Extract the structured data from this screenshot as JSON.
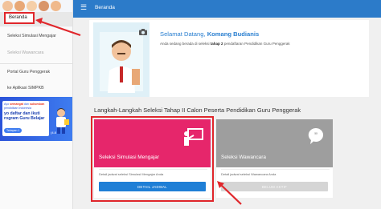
{
  "app": {
    "topbar_title": "Beranda",
    "menu_icon": "hamburger-menu-icon"
  },
  "sidebar": {
    "items": [
      {
        "label": "Beranda",
        "state": "active"
      },
      {
        "label": "Seleksi Simulasi Mengajar",
        "state": "normal"
      },
      {
        "label": "Seleksi Wawancara",
        "state": "disabled"
      },
      {
        "label": "Portal Guru Penggerak",
        "state": "normal"
      },
      {
        "label": "ke Aplikasi SIMPKB",
        "state": "normal"
      }
    ],
    "banner": {
      "line1_pre": "Ayo ",
      "line1_hl1": "semangat",
      "line1_mid": " dan ",
      "line1_hl2": "sukseskan",
      "line2": "pendidikan Indonesia",
      "headline1": "yo daftar dan ikuti",
      "headline2": "rogram Guru Belajar",
      "pill": "Tahapan 1",
      "tag": "(4.8"
    }
  },
  "welcome": {
    "greeting": "Selamat Datang, ",
    "name": "Komang Budianis",
    "sub_pre": "Anda sedang berada di seleksi ",
    "sub_bold": "tahap 2",
    "sub_post": " pendaftaran Pendidikan Guru Penggerak",
    "camera_icon": "camera-icon"
  },
  "section": {
    "title": "Langkah-Langkah Seleksi Tahap II Calon Peserta Pendidikan Guru Penggerak"
  },
  "cards": [
    {
      "title": "Seleksi Simulasi Mengajar",
      "desc": "Detail jadwal seleksi Simulasi Mengajar Anda",
      "button": "DETAIL JADWAL",
      "icon": "teacher-board-icon",
      "color": "#e6266b",
      "enabled": true
    },
    {
      "title": "Seleksi Wawancara",
      "desc": "Detail jadwal seleksi Wawancara Anda",
      "button": "BELUM AKTIF",
      "icon": "quote-bubble-icon",
      "color": "#9e9e9e",
      "enabled": false
    }
  ],
  "colors": {
    "topbar": "#2c7bc9",
    "accent_blue": "#2a7fd0",
    "highlight_red": "#e0262b",
    "card_pink": "#e6266b",
    "card_grey": "#9e9e9e",
    "button_blue": "#1f7fd6"
  }
}
